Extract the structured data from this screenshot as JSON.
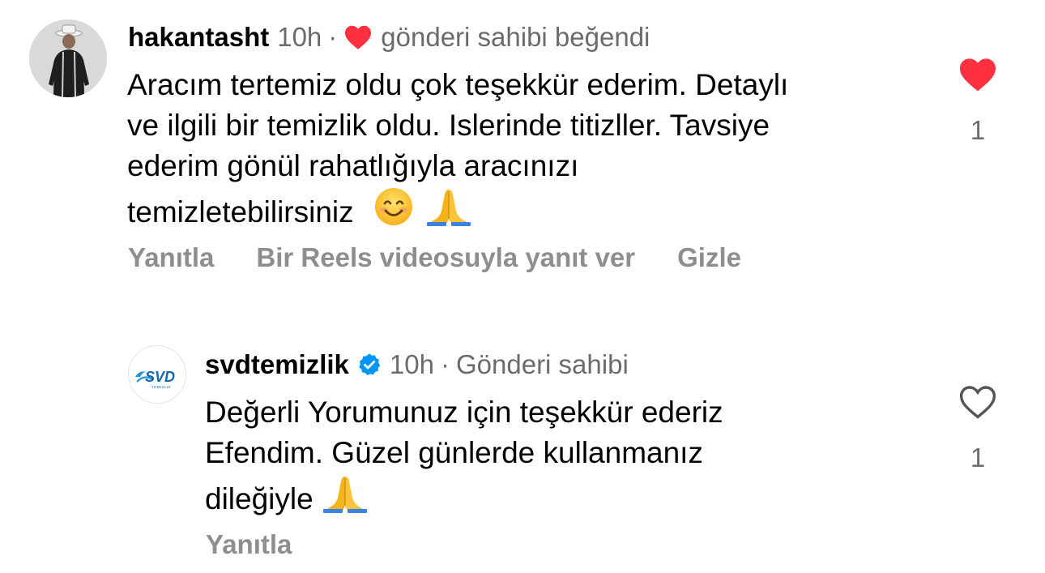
{
  "comments": [
    {
      "username": "hakantasht",
      "time": "10h",
      "dot": "·",
      "liked_text": "gönderi sahibi beğendi",
      "lines": [
        "Aracım tertemiz oldu çok teşekkür ederim. Detaylı",
        "ve ilgili bir temizlik oldu. Islerinde titizller. Tavsiye",
        "ederim gönül rahatlığıyla aracınızı",
        "temizletebilirsiniz"
      ],
      "emojis": [
        "smiling-face-icon",
        "folded-hands-icon"
      ],
      "actions": {
        "reply": "Yanıtla",
        "reels_reply": "Bir Reels videosuyla yanıt ver",
        "hide": "Gizle"
      },
      "like_count": "1",
      "liked": true
    },
    {
      "username": "svdtemizlik",
      "verified": true,
      "time": "10h",
      "dot": "·",
      "owner_text": "Gönderi sahibi",
      "lines": [
        "Değerli Yorumunuz için teşekkür ederiz",
        "Efendim. Güzel günlerde kullanmanız",
        "dileğiyle"
      ],
      "emojis": [
        "folded-hands-icon"
      ],
      "actions": {
        "reply": "Yanıtla"
      },
      "like_count": "1",
      "liked": false,
      "avatar_logo_text": "SVD",
      "avatar_logo_subtext": "TEMIZLIK"
    }
  ],
  "colors": {
    "like_red": "#ff3040",
    "verified_blue": "#0095f6",
    "muted": "#6b6b6b",
    "action_gray": "#8e8e8e"
  }
}
